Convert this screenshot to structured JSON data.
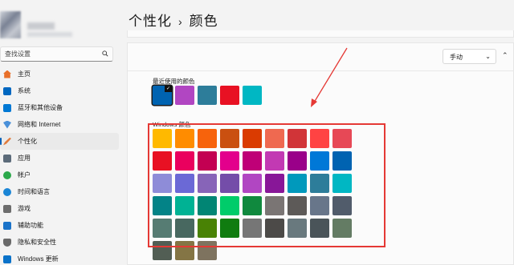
{
  "breadcrumb": {
    "parent": "个性化",
    "separator": "›",
    "current": "颜色"
  },
  "search": {
    "placeholder": "查找设置"
  },
  "sidebar": {
    "items": [
      {
        "label": "主页",
        "icon": "home-icon",
        "active": false,
        "color": "#e8702a"
      },
      {
        "label": "系统",
        "icon": "system-icon",
        "active": false,
        "color": "#0067c0"
      },
      {
        "label": "蓝牙和其他设备",
        "icon": "bluetooth-icon",
        "active": false,
        "color": "#0078d4"
      },
      {
        "label": "网络和 Internet",
        "icon": "network-icon",
        "active": false,
        "color": "#4a90d9"
      },
      {
        "label": "个性化",
        "icon": "personalization-icon",
        "active": true,
        "color": "#e07a3c"
      },
      {
        "label": "应用",
        "icon": "apps-icon",
        "active": false,
        "color": "#5c6b7a"
      },
      {
        "label": "帐户",
        "icon": "accounts-icon",
        "active": false,
        "color": "#2ba84a"
      },
      {
        "label": "时间和语言",
        "icon": "time-language-icon",
        "active": false,
        "color": "#1b86d6"
      },
      {
        "label": "游戏",
        "icon": "gaming-icon",
        "active": false,
        "color": "#6d6d6d"
      },
      {
        "label": "辅助功能",
        "icon": "accessibility-icon",
        "active": false,
        "color": "#1a73c9"
      },
      {
        "label": "隐私和安全性",
        "icon": "privacy-shield-icon",
        "active": false,
        "color": "#6a6a6a"
      },
      {
        "label": "Windows 更新",
        "icon": "windows-update-icon",
        "active": false,
        "color": "#0a72c9"
      }
    ]
  },
  "accent": {
    "mode_value": "手动",
    "recent_label": "最近使用的颜色",
    "windows_label": "Windows 颜色",
    "recent_colors": [
      "#0063b1",
      "#b146c2",
      "#2d7d9a",
      "#e81123",
      "#00b7c3"
    ],
    "selected_recent_index": 0,
    "windows_colors": [
      [
        "#ffb900",
        "#ff8c00",
        "#f7630c",
        "#ca5010",
        "#da3b01",
        "#ef6950",
        "#d13438",
        "#ff4343",
        "#e74856"
      ],
      [
        "#e81123",
        "#ea005e",
        "#c30052",
        "#e3008c",
        "#bf0077",
        "#c239b3",
        "#9a0089",
        "#0078d7",
        "#0063b1"
      ],
      [
        "#8e8cd8",
        "#6b69d6",
        "#8764b8",
        "#744da9",
        "#b146c2",
        "#881798",
        "#0099bc",
        "#2d7d9a",
        "#00b7c3"
      ],
      [
        "#038387",
        "#00b294",
        "#018574",
        "#00cc6a",
        "#10893e",
        "#7a7574",
        "#5d5a58",
        "#68768a",
        "#515c6b"
      ],
      [
        "#567c73",
        "#486860",
        "#498205",
        "#107c10",
        "#767676",
        "#4c4a48",
        "#69797e",
        "#4a5459",
        "#647c64"
      ],
      [
        "#525e54",
        "#847545",
        "#7e735f"
      ]
    ]
  },
  "annotation": {
    "color": "#e53935"
  }
}
